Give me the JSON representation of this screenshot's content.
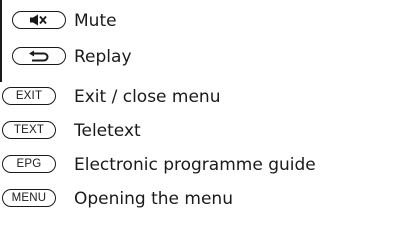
{
  "legend": {
    "items": [
      {
        "icon": "speaker-mute-icon",
        "key_text": "",
        "description": "Mute"
      },
      {
        "icon": "return-arrow-icon",
        "key_text": "",
        "description": "Replay"
      },
      {
        "icon": "",
        "key_text": "EXIT",
        "description": "Exit / close menu"
      },
      {
        "icon": "",
        "key_text": "TEXT",
        "description": "Teletext"
      },
      {
        "icon": "",
        "key_text": "EPG",
        "description": "Electronic programme guide"
      },
      {
        "icon": "",
        "key_text": "MENU",
        "description": "Opening the menu"
      }
    ]
  }
}
